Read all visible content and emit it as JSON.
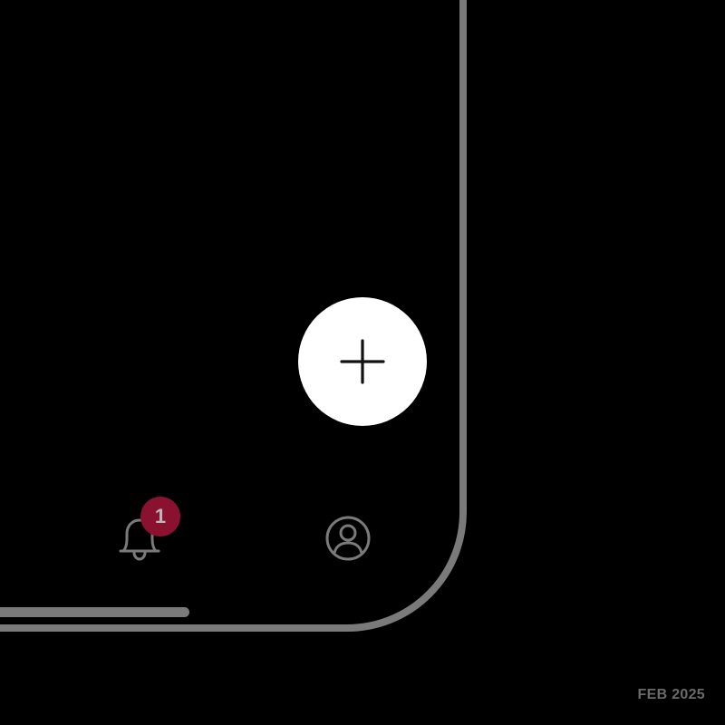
{
  "tab_bar": {
    "notifications": {
      "icon": "bell-icon",
      "badge_count": "1",
      "badge_color": "#8a1230"
    },
    "profile": {
      "icon": "user-circle-icon"
    }
  },
  "fab": {
    "icon": "plus-icon",
    "background": "#ffffff"
  },
  "footer": {
    "date": "FEB 2025"
  },
  "colors": {
    "background": "#000000",
    "frame": "#7a7a7a",
    "icon_gray": "#7a7a7a"
  }
}
